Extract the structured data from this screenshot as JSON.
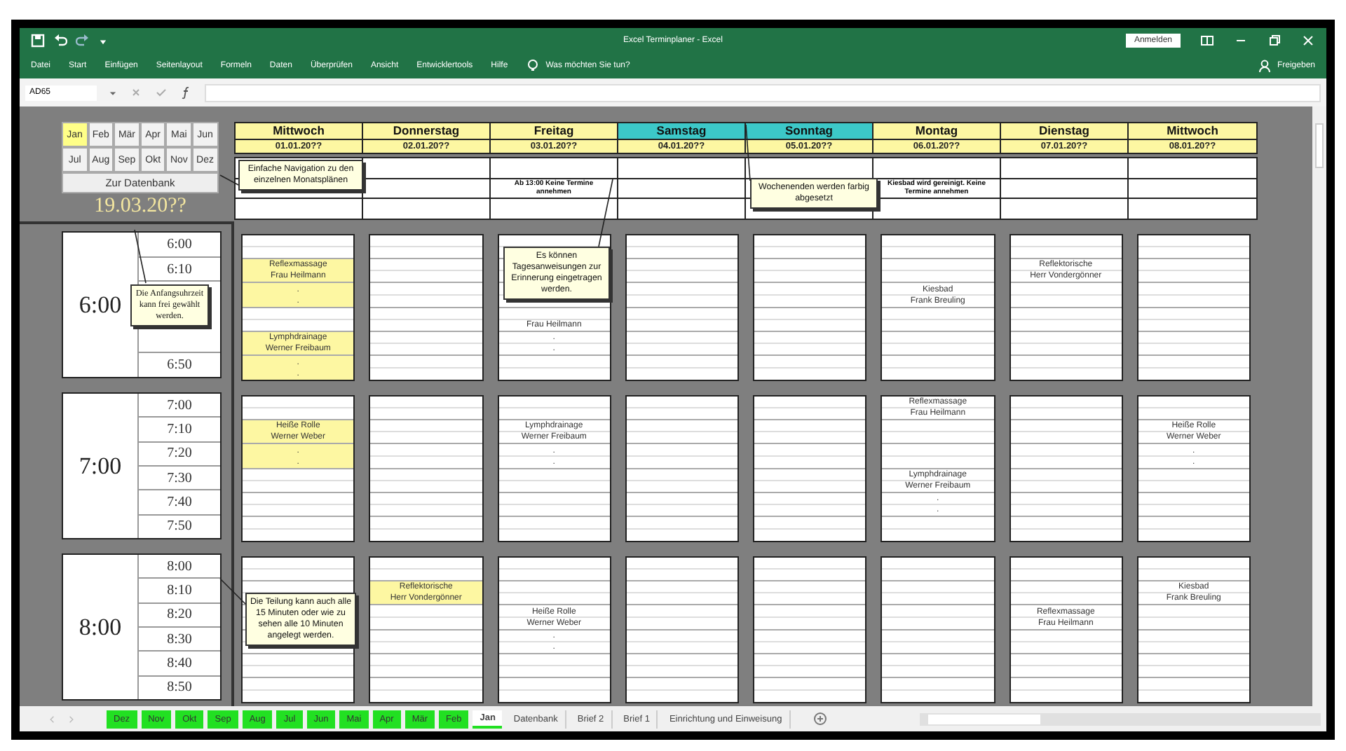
{
  "window": {
    "title": "Excel Terminplaner - Excel",
    "signin": "Anmelden",
    "share": "Freigeben"
  },
  "ribbon_tabs": [
    "Datei",
    "Start",
    "Einfügen",
    "Seitenlayout",
    "Formeln",
    "Daten",
    "Überprüfen",
    "Ansicht",
    "Entwicklertools",
    "Hilfe"
  ],
  "tell_me": "Was möchten Sie tun?",
  "formula_bar": {
    "name_box": "AD65"
  },
  "months": [
    {
      "label": "Jan",
      "selected": true
    },
    {
      "label": "Feb",
      "selected": false
    },
    {
      "label": "Mär",
      "selected": false
    },
    {
      "label": "Apr",
      "selected": false
    },
    {
      "label": "Mai",
      "selected": false
    },
    {
      "label": "Jun",
      "selected": false
    },
    {
      "label": "Jul",
      "selected": false
    },
    {
      "label": "Aug",
      "selected": false
    },
    {
      "label": "Sep",
      "selected": false
    },
    {
      "label": "Okt",
      "selected": false
    },
    {
      "label": "Nov",
      "selected": false
    },
    {
      "label": "Dez",
      "selected": false
    }
  ],
  "database_button": "Zur Datenbank",
  "current_date": "19.03.20??",
  "days": [
    {
      "name": "Mittwoch",
      "date": "01.01.20??",
      "weekend": false
    },
    {
      "name": "Donnerstag",
      "date": "02.01.20??",
      "weekend": false
    },
    {
      "name": "Freitag",
      "date": "03.01.20??",
      "weekend": false,
      "note": "Ab 13:00 Keine Termine annehmen"
    },
    {
      "name": "Samstag",
      "date": "04.01.20??",
      "weekend": true
    },
    {
      "name": "Sonntag",
      "date": "05.01.20??",
      "weekend": true
    },
    {
      "name": "Montag",
      "date": "06.01.20??",
      "weekend": false,
      "note": "Kiesbad wird gereinigt. Keine Termine annehmen"
    },
    {
      "name": "Dienstag",
      "date": "07.01.20??",
      "weekend": false
    },
    {
      "name": "Mittwoch",
      "date": "08.01.20??",
      "weekend": false
    }
  ],
  "hours": [
    {
      "label": "6:00",
      "slots": [
        {
          "kind": "time",
          "time": "6:00"
        },
        {
          "kind": "time",
          "time": "6:10"
        },
        {
          "kind": "comment",
          "text": "Die Anfangsuhrzeit kann frei gewählt werden."
        },
        {
          "kind": "time",
          "time": "6:50"
        }
      ],
      "columns": [
        [
          null,
          {
            "lines": [
              "Reflexmassage",
              "Frau Heilmann"
            ],
            "highlight": true
          },
          {
            "lines": [
              ".",
              "."
            ],
            "highlight": true
          },
          null,
          {
            "lines": [
              "Lymphdrainage",
              "Werner Freibaum"
            ],
            "highlight": true
          },
          {
            "lines": [
              ".",
              "."
            ],
            "highlight": true
          }
        ],
        [
          null,
          null,
          null,
          null,
          null,
          null
        ],
        [
          null,
          null,
          null,
          {
            "lines": [
              "Frau Heilmann"
            ],
            "covered_top": true,
            "highlight": false
          },
          {
            "lines": [
              ".",
              "."
            ],
            "highlight": false
          },
          null
        ],
        [
          null,
          null,
          null,
          null,
          null,
          null
        ],
        [
          null,
          null,
          null,
          null,
          null,
          null
        ],
        [
          null,
          null,
          {
            "lines": [
              "Kiesbad",
              "Frank Breuling"
            ],
            "highlight": false
          },
          null,
          null,
          null
        ],
        [
          null,
          {
            "lines": [
              "Reflektorische",
              "Herr Vondergönner"
            ],
            "highlight": false
          },
          null,
          null,
          null,
          null
        ],
        [
          null,
          null,
          null,
          null,
          null,
          null
        ]
      ]
    },
    {
      "label": "7:00",
      "slots": [
        {
          "kind": "time",
          "time": "7:00"
        },
        {
          "kind": "time",
          "time": "7:10"
        },
        {
          "kind": "time",
          "time": "7:20"
        },
        {
          "kind": "time",
          "time": "7:30"
        },
        {
          "kind": "time",
          "time": "7:40"
        },
        {
          "kind": "time",
          "time": "7:50"
        }
      ],
      "columns": [
        [
          null,
          {
            "lines": [
              "Heiße Rolle",
              "Werner Weber"
            ],
            "highlight": true
          },
          {
            "lines": [
              ".",
              "."
            ],
            "highlight": true
          },
          null,
          null,
          null
        ],
        [
          null,
          null,
          null,
          null,
          null,
          null
        ],
        [
          null,
          {
            "lines": [
              "Lymphdrainage",
              "Werner Freibaum"
            ],
            "highlight": false
          },
          {
            "lines": [
              ".",
              "."
            ],
            "highlight": false
          },
          null,
          null,
          null
        ],
        [
          null,
          null,
          null,
          null,
          null,
          null
        ],
        [
          null,
          null,
          null,
          null,
          null,
          null
        ],
        [
          {
            "lines": [
              "Reflexmassage",
              "Frau Heilmann"
            ],
            "highlight": false
          },
          null,
          null,
          {
            "lines": [
              "Lymphdrainage",
              "Werner Freibaum"
            ],
            "highlight": false
          },
          {
            "lines": [
              ".",
              "."
            ],
            "highlight": false
          },
          null
        ],
        [
          null,
          null,
          null,
          null,
          null,
          null
        ],
        [
          null,
          {
            "lines": [
              "Heiße Rolle",
              "Werner Weber"
            ],
            "highlight": false
          },
          {
            "lines": [
              ".",
              "."
            ],
            "highlight": false
          },
          null,
          null,
          null
        ]
      ]
    },
    {
      "label": "8:00",
      "slots": [
        {
          "kind": "time",
          "time": "8:00"
        },
        {
          "kind": "time",
          "time": "8:10"
        },
        {
          "kind": "time",
          "time": "8:20"
        },
        {
          "kind": "time",
          "time": "8:30"
        },
        {
          "kind": "time",
          "time": "8:40"
        },
        {
          "kind": "time",
          "time": "8:50"
        }
      ],
      "columns": [
        [
          null,
          null,
          null,
          null,
          null,
          null
        ],
        [
          null,
          {
            "lines": [
              "Reflektorische",
              "Herr Vondergönner"
            ],
            "highlight": true
          },
          null,
          null,
          null,
          null
        ],
        [
          null,
          null,
          {
            "lines": [
              "Heiße Rolle",
              "Werner Weber"
            ],
            "highlight": false
          },
          {
            "lines": [
              ".",
              "."
            ],
            "highlight": false
          },
          null,
          null
        ],
        [
          null,
          null,
          null,
          null,
          null,
          null
        ],
        [
          null,
          null,
          null,
          null,
          null,
          null
        ],
        [
          null,
          null,
          null,
          null,
          null,
          null
        ],
        [
          null,
          null,
          {
            "lines": [
              "Reflexmassage",
              "Frau Heilmann"
            ],
            "highlight": false
          },
          null,
          null,
          null
        ],
        [
          null,
          {
            "lines": [
              "Kiesbad",
              "Frank Breuling"
            ],
            "highlight": false
          },
          null,
          null,
          null,
          null
        ]
      ]
    }
  ],
  "comments": [
    "Einfache Navigation zu den einzelnen Monatsplänen",
    "Wochenenden werden farbig abgesetzt",
    "Es können Tagesanweisungen zur Erinnerung eingetragen werden.",
    "Die Teilung kann auch alle 15 Minuten oder wie zu sehen alle 10 Minuten angelegt werden."
  ],
  "sheet_tabs": [
    {
      "label": "Dez",
      "color": "#22e022",
      "selected": false
    },
    {
      "label": "Nov",
      "color": "#22e022",
      "selected": false
    },
    {
      "label": "Okt",
      "color": "#22e022",
      "selected": false
    },
    {
      "label": "Sep",
      "color": "#22e022",
      "selected": false
    },
    {
      "label": "Aug",
      "color": "#22e022",
      "selected": false
    },
    {
      "label": "Jul",
      "color": "#22e022",
      "selected": false
    },
    {
      "label": "Jun",
      "color": "#22e022",
      "selected": false
    },
    {
      "label": "Mai",
      "color": "#22e022",
      "selected": false
    },
    {
      "label": "Apr",
      "color": "#22e022",
      "selected": false
    },
    {
      "label": "Mär",
      "color": "#22e022",
      "selected": false
    },
    {
      "label": "Feb",
      "color": "#22e022",
      "selected": false
    },
    {
      "label": "Jan",
      "color": "#22e022",
      "selected": true
    },
    {
      "label": "Datenbank",
      "selected": false
    },
    {
      "label": "Brief 2",
      "selected": false
    },
    {
      "label": "Brief 1",
      "selected": false
    },
    {
      "label": "Einrichtung und Einweisung",
      "selected": false
    }
  ]
}
